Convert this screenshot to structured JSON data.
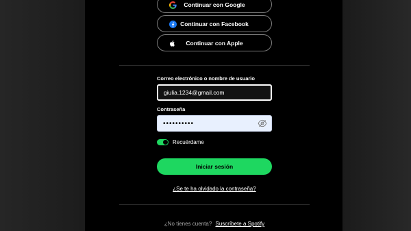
{
  "social": {
    "google_label": "Continuar con Google",
    "facebook_label": "Continuar con Facebook",
    "apple_label": "Continuar con Apple"
  },
  "form": {
    "email_label": "Correo electrónico o nombre de usuario",
    "email_value": "giulia.1234@gmail.com",
    "password_label": "Contraseña",
    "password_value": "••••••••••",
    "remember_label": "Recuérdame",
    "remember_on": true,
    "login_label": "Iniciar sesión",
    "forgot_label": "¿Se te ha olvidado la contraseña?"
  },
  "footer": {
    "question": "¿No tienes cuenta?",
    "signup_link": "Suscríbete a Spotify"
  },
  "colors": {
    "accent": "#1ed760",
    "panel": "#000000",
    "backdrop": "#1a1a1a",
    "autofill": "#e8f0fe"
  },
  "icons": {
    "google": "google-icon",
    "facebook": "facebook-icon",
    "apple": "apple-icon",
    "password_visibility": "eye-slash-icon"
  }
}
